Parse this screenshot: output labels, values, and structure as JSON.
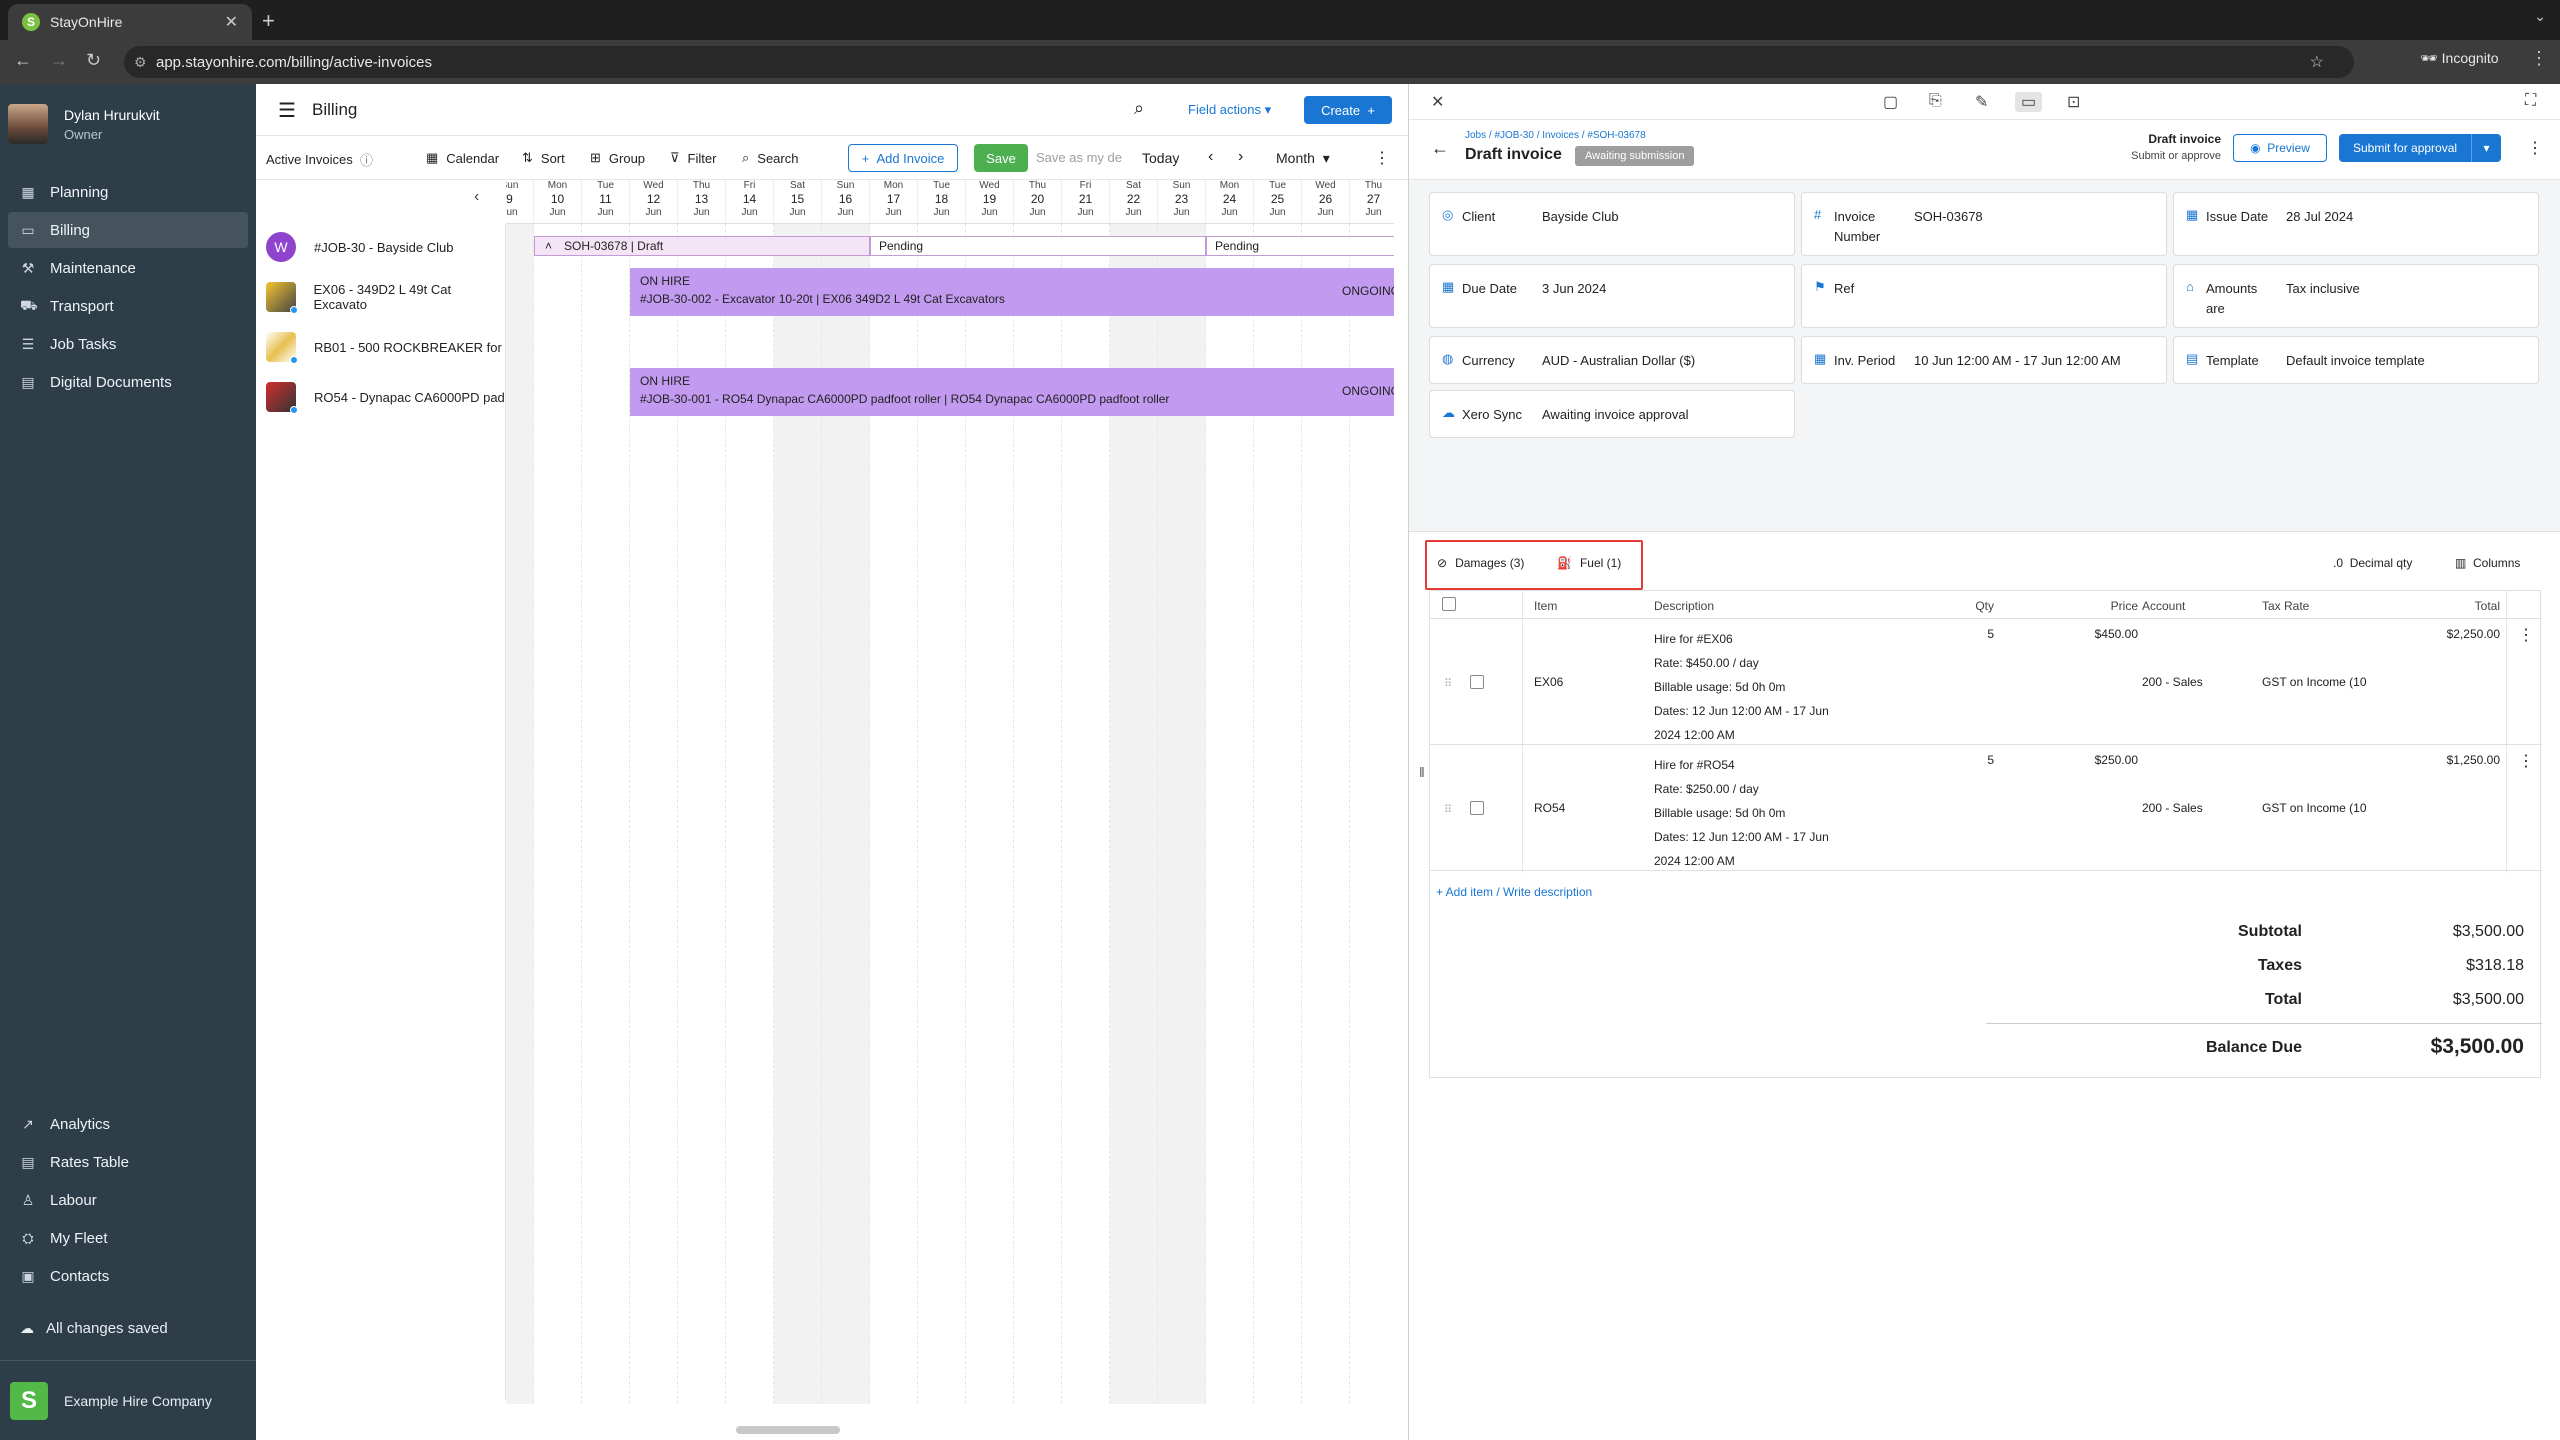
{
  "browser": {
    "tab_title": "StayOnHire",
    "url": "app.stayonhire.com/billing/active-invoices",
    "incognito_label": "Incognito"
  },
  "sidebar": {
    "user_name": "Dylan Hrurukvit",
    "user_role": "Owner",
    "top_items": [
      {
        "label": "Planning",
        "icon": "calendar-grid-icon"
      },
      {
        "label": "Billing",
        "icon": "credit-card-icon"
      },
      {
        "label": "Maintenance",
        "icon": "wrench-icon"
      },
      {
        "label": "Transport",
        "icon": "truck-icon"
      },
      {
        "label": "Job Tasks",
        "icon": "task-list-icon"
      },
      {
        "label": "Digital Documents",
        "icon": "document-icon"
      }
    ],
    "bottom_items": [
      {
        "label": "Analytics",
        "icon": "chart-icon"
      },
      {
        "label": "Rates Table",
        "icon": "table-icon"
      },
      {
        "label": "Labour",
        "icon": "person-icon"
      },
      {
        "label": "My Fleet",
        "icon": "fleet-icon"
      },
      {
        "label": "Contacts",
        "icon": "contacts-icon"
      }
    ],
    "save_status": "All changes saved",
    "company_name": "Example Hire Company",
    "company_initial": "S"
  },
  "billing": {
    "title": "Billing",
    "field_actions": "Field actions",
    "create_label": "Create",
    "view_name": "Active Invoices",
    "toolbar": {
      "calendar": "Calendar",
      "sort": "Sort",
      "group": "Group",
      "filter": "Filter",
      "search": "Search",
      "add_invoice": "Add Invoice",
      "save": "Save",
      "save_as": "Save as my de",
      "today": "Today",
      "range": "Month"
    },
    "days": [
      {
        "wd": "Sun",
        "d": "9",
        "m": "Jun",
        "weekend": true
      },
      {
        "wd": "Mon",
        "d": "10",
        "m": "Jun",
        "weekend": false
      },
      {
        "wd": "Tue",
        "d": "11",
        "m": "Jun",
        "weekend": false
      },
      {
        "wd": "Wed",
        "d": "12",
        "m": "Jun",
        "weekend": false
      },
      {
        "wd": "Thu",
        "d": "13",
        "m": "Jun",
        "weekend": false
      },
      {
        "wd": "Fri",
        "d": "14",
        "m": "Jun",
        "weekend": false
      },
      {
        "wd": "Sat",
        "d": "15",
        "m": "Jun",
        "weekend": true
      },
      {
        "wd": "Sun",
        "d": "16",
        "m": "Jun",
        "weekend": true
      },
      {
        "wd": "Mon",
        "d": "17",
        "m": "Jun",
        "weekend": false
      },
      {
        "wd": "Tue",
        "d": "18",
        "m": "Jun",
        "weekend": false
      },
      {
        "wd": "Wed",
        "d": "19",
        "m": "Jun",
        "weekend": false
      },
      {
        "wd": "Thu",
        "d": "20",
        "m": "Jun",
        "weekend": false
      },
      {
        "wd": "Fri",
        "d": "21",
        "m": "Jun",
        "weekend": false
      },
      {
        "wd": "Sat",
        "d": "22",
        "m": "Jun",
        "weekend": true
      },
      {
        "wd": "Sun",
        "d": "23",
        "m": "Jun",
        "weekend": true
      },
      {
        "wd": "Mon",
        "d": "24",
        "m": "Jun",
        "weekend": false
      },
      {
        "wd": "Tue",
        "d": "25",
        "m": "Jun",
        "weekend": false
      },
      {
        "wd": "Wed",
        "d": "26",
        "m": "Jun",
        "weekend": false
      },
      {
        "wd": "Thu",
        "d": "27",
        "m": "Jun",
        "weekend": false
      }
    ],
    "rows": [
      {
        "label": "#JOB-30 - Bayside Club"
      },
      {
        "label": "EX06 - 349D2 L 49t Cat Excavato"
      },
      {
        "label": "RB01 - 500 ROCKBREAKER for"
      },
      {
        "label": "RO54 - Dynapac CA6000PD pad"
      }
    ],
    "job_avatar": "W",
    "invoice_bar": "SOH-03678 | Draft",
    "pending_label": "Pending",
    "hire_bars": [
      {
        "status": "ON HIRE",
        "text": "#JOB-30-002 - Excavator 10-20t | EX06 349D2 L 49t Cat Excavators",
        "state": "ONGOING"
      },
      {
        "status": "ON HIRE",
        "text": "#JOB-30-001 - RO54 Dynapac CA6000PD padfoot roller | RO54 Dynapac CA6000PD padfoot roller",
        "state": "ONGOING"
      }
    ]
  },
  "invoice": {
    "breadcrumb": "Jobs / #JOB-30 / Invoices / #SOH-03678",
    "title": "Draft invoice",
    "badge": "Awaiting submission",
    "state_title": "Draft invoice",
    "state_sub": "Submit or approve",
    "preview": "Preview",
    "submit": "Submit for approval",
    "fields": {
      "client_label": "Client",
      "client": "Bayside Club",
      "number_label": "Invoice Number",
      "number": "SOH-03678",
      "issue_label": "Issue Date",
      "issue": "28 Jul 2024",
      "due_label": "Due Date",
      "due": "3 Jun 2024",
      "ref_label": "Ref",
      "amounts_label": "Amounts are",
      "amounts": "Tax inclusive",
      "currency_label": "Currency",
      "currency": "AUD - Australian Dollar ($)",
      "period_label": "Inv. Period",
      "period": "10 Jun 12:00 AM - 17 Jun 12:00 AM",
      "template_label": "Template",
      "template": "Default invoice template",
      "xero_label": "Xero Sync",
      "xero": "Awaiting invoice approval"
    },
    "tabs": {
      "damages": "Damages (3)",
      "fuel": "Fuel (1)",
      "decimal": "Decimal qty",
      "columns": "Columns"
    },
    "columns": {
      "item": "Item",
      "description": "Description",
      "qty": "Qty",
      "price": "Price",
      "account": "Account",
      "tax": "Tax Rate",
      "total": "Total"
    },
    "lines": [
      {
        "item": "EX06",
        "d1": "Hire for #EX06",
        "d2": "Rate: $450.00 / day",
        "d3": "Billable usage: 5d 0h 0m",
        "d4": "Dates: 12 Jun 12:00 AM - 17 Jun",
        "d5": "2024 12:00 AM",
        "qty": "5",
        "price": "$450.00",
        "account": "200 - Sales",
        "tax": "GST on Income (10",
        "total": "$2,250.00"
      },
      {
        "item": "RO54",
        "d1": "Hire for #RO54",
        "d2": "Rate: $250.00 / day",
        "d3": "Billable usage: 5d 0h 0m",
        "d4": "Dates: 12 Jun 12:00 AM - 17 Jun",
        "d5": "2024 12:00 AM",
        "qty": "5",
        "price": "$250.00",
        "account": "200 - Sales",
        "tax": "GST on Income (10",
        "total": "$1,250.00"
      }
    ],
    "add_item": "+ Add item / Write description",
    "totals": {
      "subtotal_label": "Subtotal",
      "subtotal": "$3,500.00",
      "taxes_label": "Taxes",
      "taxes": "$318.18",
      "total_label": "Total",
      "total": "$3,500.00",
      "balance_label": "Balance Due",
      "balance": "$3,500.00"
    }
  }
}
